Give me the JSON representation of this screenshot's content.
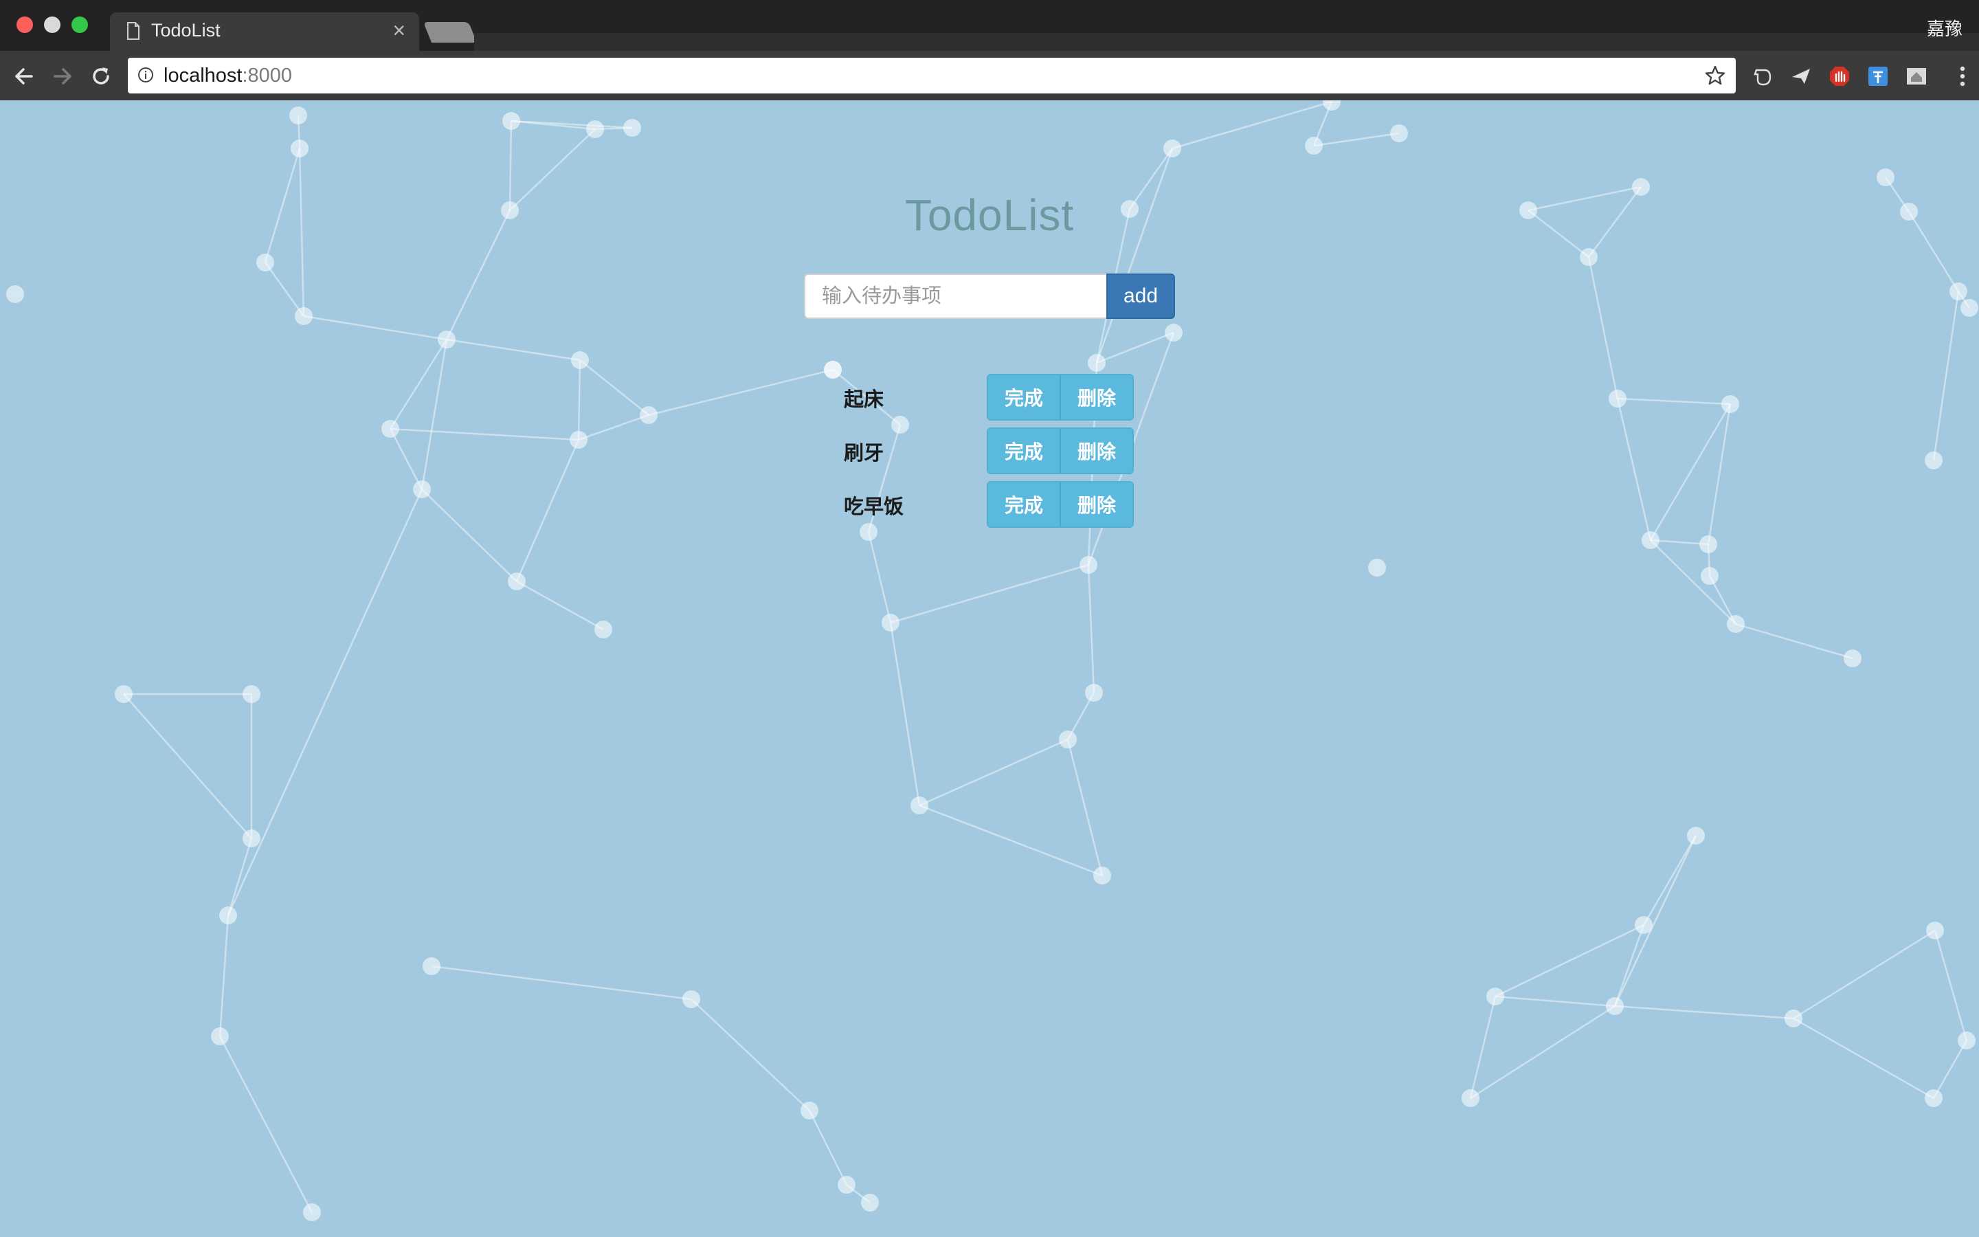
{
  "browser": {
    "tab_title": "TodoList",
    "tab_close": "×",
    "profile_name": "嘉豫",
    "url_host": "localhost",
    "url_port": ":8000"
  },
  "app": {
    "title": "TodoList",
    "input_placeholder": "输入待办事项",
    "add_label": "add",
    "done_label": "完成",
    "delete_label": "删除",
    "todos": [
      {
        "text": "起床"
      },
      {
        "text": "刷牙"
      },
      {
        "text": "吃早饭"
      }
    ]
  },
  "colors": {
    "background": "#a2c9e0",
    "primary_button": "#3a78b5",
    "info_button": "#5bb9de",
    "title_text": "#6a9aa0"
  }
}
